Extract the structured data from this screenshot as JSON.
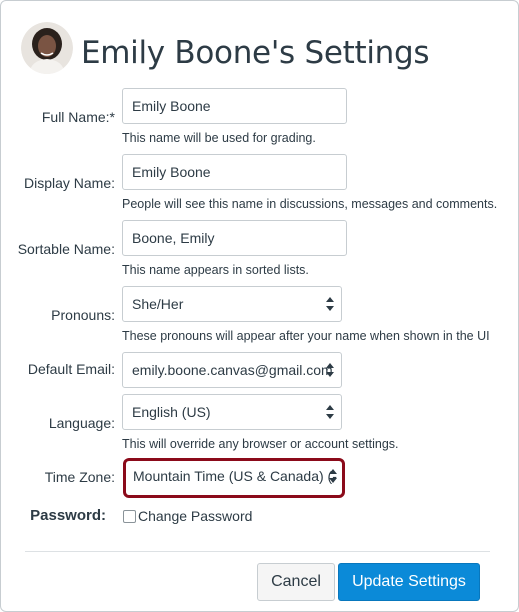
{
  "header": {
    "title": "Emily Boone's Settings"
  },
  "form": {
    "full_name": {
      "label": "Full Name:*",
      "value": "Emily Boone",
      "hint": "This name will be used for grading."
    },
    "display_name": {
      "label": "Display Name:",
      "value": "Emily Boone",
      "hint": "People will see this name in discussions, messages and comments."
    },
    "sortable_name": {
      "label": "Sortable Name:",
      "value": "Boone, Emily",
      "hint": "This name appears in sorted lists."
    },
    "pronouns": {
      "label": "Pronouns:",
      "value": "She/Her",
      "hint": "These pronouns will appear after your name when shown in the UI"
    },
    "default_email": {
      "label": "Default Email:",
      "value": "emily.boone.canvas@gmail.com"
    },
    "language": {
      "label": "Language:",
      "value": "English (US)",
      "hint": "This will override any browser or account settings."
    },
    "time_zone": {
      "label": "Time Zone:",
      "value": "Mountain Time (US & Canada) (-"
    },
    "password": {
      "label": "Password:",
      "checkbox_label": "Change Password"
    }
  },
  "actions": {
    "cancel_label": "Cancel",
    "update_label": "Update Settings"
  },
  "colors": {
    "primary": "#0b8ad8",
    "highlight": "#8b0a1a",
    "text": "#2d3b45"
  },
  "icons": {
    "select_arrows": "up-down-arrows-icon",
    "avatar": "user-avatar"
  }
}
